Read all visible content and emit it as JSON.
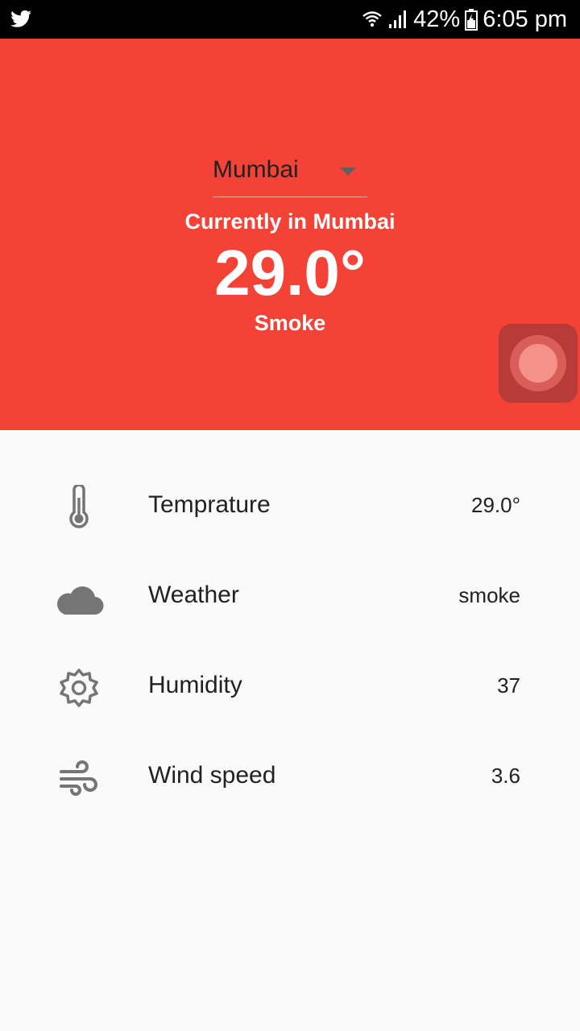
{
  "status_bar": {
    "battery": "42%",
    "time": "6:05 pm",
    "icons": [
      "twitter-icon",
      "wifi-icon",
      "signal-icon",
      "battery-icon"
    ]
  },
  "header": {
    "selected_city": "Mumbai",
    "current_label": "Currently in Mumbai",
    "temperature": "29.0°",
    "condition": "Smoke",
    "background_color": "#f44336"
  },
  "details": [
    {
      "icon": "thermometer-icon",
      "label": "Temprature",
      "value": "29.0°"
    },
    {
      "icon": "cloud-icon",
      "label": "Weather",
      "value": "smoke"
    },
    {
      "icon": "gear-icon",
      "label": "Humidity",
      "value": "37"
    },
    {
      "icon": "wind-icon",
      "label": "Wind speed",
      "value": "3.6"
    }
  ]
}
